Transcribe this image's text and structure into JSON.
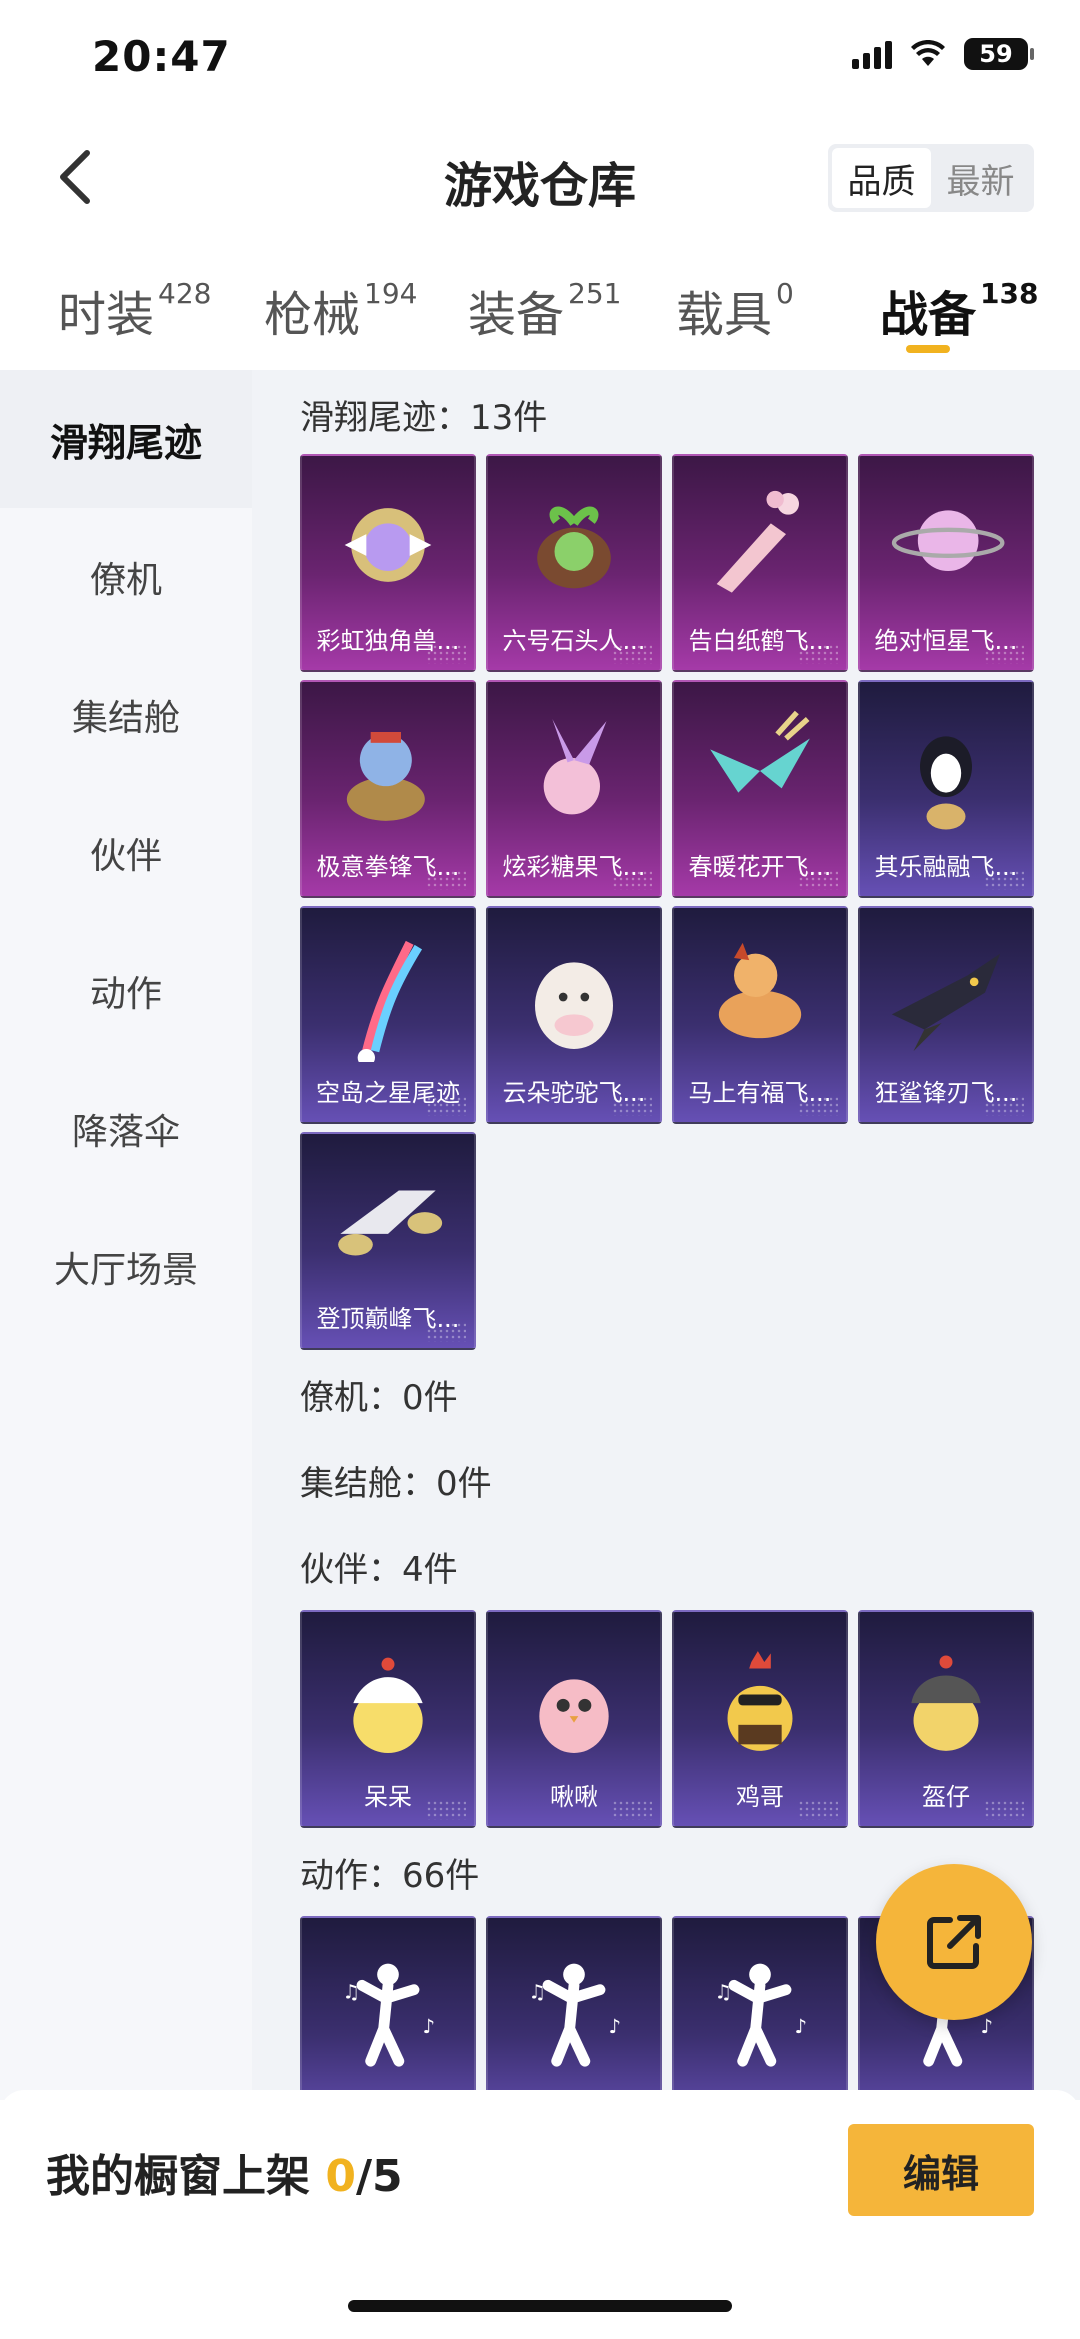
{
  "status": {
    "time": "20:47",
    "battery": "59"
  },
  "header": {
    "title": "游戏仓库",
    "sort_options": [
      "品质",
      "最新"
    ],
    "active_sort": 0
  },
  "tabs": [
    {
      "label": "时装",
      "count": "428"
    },
    {
      "label": "枪械",
      "count": "194"
    },
    {
      "label": "装备",
      "count": "251"
    },
    {
      "label": "载具",
      "count": "0"
    },
    {
      "label": "战备",
      "count": "138"
    }
  ],
  "active_tab": 4,
  "sidebar": [
    "滑翔尾迹",
    "僚机",
    "集结舱",
    "伙伴",
    "动作",
    "降落伞",
    "大厅场景"
  ],
  "sections": {
    "glide": {
      "title": "滑翔尾迹：13件"
    },
    "wingman": {
      "title": "僚机：0件"
    },
    "assembly": {
      "title": "集结舱：0件"
    },
    "partner": {
      "title": "伙伴：4件"
    },
    "emote": {
      "title": "动作：66件"
    }
  },
  "glide_items": [
    {
      "name": "彩虹独角兽...",
      "rarity": "purple",
      "icon": "unicorn-emblem-icon"
    },
    {
      "name": "六号石头人...",
      "rarity": "purple",
      "icon": "sprout-creature-icon"
    },
    {
      "name": "告白纸鹤飞...",
      "rarity": "purple",
      "icon": "paper-crane-icon"
    },
    {
      "name": "绝对恒星飞...",
      "rarity": "purple",
      "icon": "planet-icon"
    },
    {
      "name": "极意拳锋飞...",
      "rarity": "purple",
      "icon": "genie-lamp-icon"
    },
    {
      "name": "炫彩糖果飞...",
      "rarity": "purple",
      "icon": "candy-flower-icon"
    },
    {
      "name": "春暖花开飞...",
      "rarity": "purple",
      "icon": "butterfly-icon"
    },
    {
      "name": "其乐融融飞...",
      "rarity": "blue",
      "icon": "penguin-balloon-icon"
    },
    {
      "name": "空岛之星尾迹",
      "rarity": "blue",
      "icon": "rainbow-trail-icon"
    },
    {
      "name": "云朵驼驼飞...",
      "rarity": "blue",
      "icon": "alpaca-icon"
    },
    {
      "name": "马上有福飞...",
      "rarity": "blue",
      "icon": "horse-icon"
    },
    {
      "name": "狂鲨锋刃飞...",
      "rarity": "blue",
      "icon": "shark-icon"
    },
    {
      "name": "登顶巅峰飞...",
      "rarity": "blue",
      "icon": "jet-glider-icon"
    }
  ],
  "partner_items": [
    {
      "name": "呆呆",
      "rarity": "blue",
      "icon": "chick-icon"
    },
    {
      "name": "啾啾",
      "rarity": "blue",
      "icon": "pink-chick-icon"
    },
    {
      "name": "鸡哥",
      "rarity": "blue",
      "icon": "rooster-icon"
    },
    {
      "name": "盔仔",
      "rarity": "blue",
      "icon": "helmet-chick-icon"
    }
  ],
  "emote_items": [
    {
      "rarity": "blue",
      "icon": "dance-emote-icon"
    },
    {
      "rarity": "blue",
      "icon": "dance-emote-icon"
    },
    {
      "rarity": "blue",
      "icon": "dance-emote-icon"
    },
    {
      "rarity": "blue",
      "icon": "dance-emote-icon"
    }
  ],
  "bottom": {
    "shelf_label": "我的橱窗上架",
    "current": "0",
    "total": "/5",
    "edit_label": "编辑"
  }
}
